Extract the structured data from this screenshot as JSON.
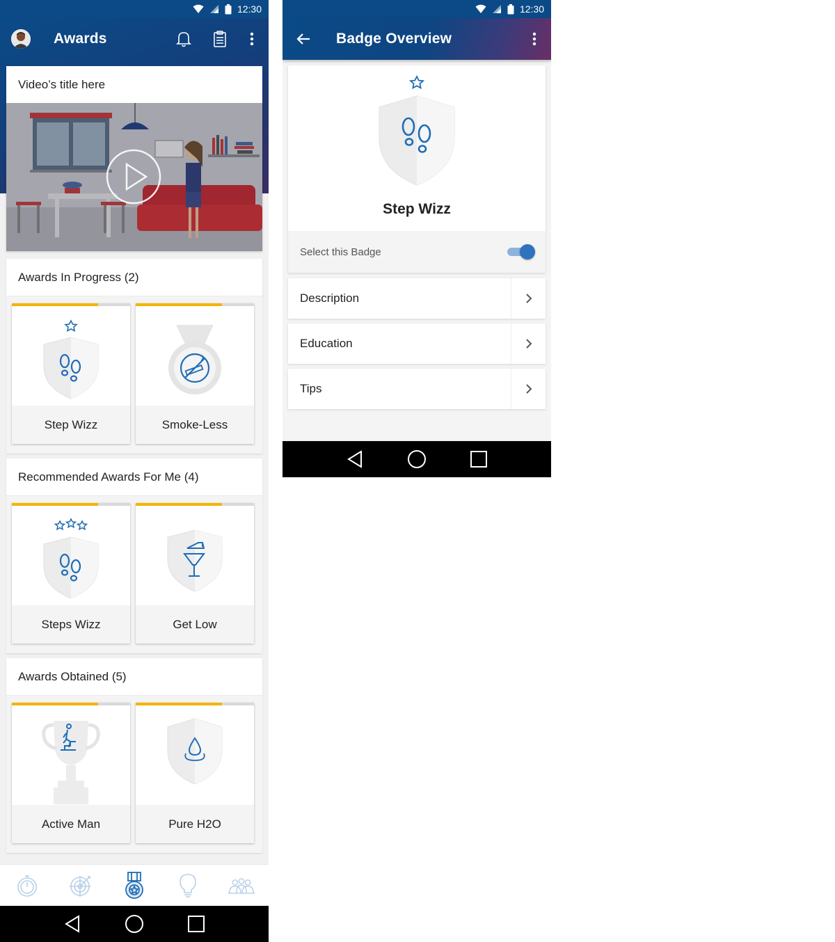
{
  "status_bar": {
    "time": "12:30"
  },
  "awards_screen": {
    "title": "Awards",
    "icons": [
      "avatar",
      "bell-icon",
      "clipboard-icon",
      "more-vert-icon"
    ],
    "video": {
      "title": "Video’s title here"
    },
    "sections": [
      {
        "title": "Awards In Progress (2)",
        "tiles": [
          {
            "label": "Step Wizz",
            "icon": "footsteps-shield-icon",
            "stars": 1,
            "progress": 0.73
          },
          {
            "label": "Smoke-Less",
            "icon": "no-smoking-medal-icon",
            "stars": 0,
            "progress": 0.73
          }
        ]
      },
      {
        "title": "Recommended Awards For Me (4)",
        "tiles": [
          {
            "label": "Steps Wizz",
            "icon": "footsteps-shield-icon",
            "stars": 3,
            "progress": 0.73
          },
          {
            "label": "Get Low",
            "icon": "cocktail-shield-icon",
            "stars": 0,
            "progress": 0.73
          }
        ]
      },
      {
        "title": "Awards Obtained (5)",
        "tiles": [
          {
            "label": "Active Man",
            "icon": "stairs-trophy-icon",
            "stars": 0,
            "progress": 0.73
          },
          {
            "label": "Pure H2O",
            "icon": "water-drop-shield-icon",
            "stars": 0,
            "progress": 0.73
          }
        ]
      }
    ],
    "bottom_nav": [
      "stopwatch-icon",
      "target-icon",
      "award-medal-icon",
      "lightbulb-icon",
      "community-icon"
    ],
    "active_nav": "award-medal-icon"
  },
  "badge_overview": {
    "title": "Badge Overview",
    "badge_name": "Step Wizz",
    "select_label": "Select this Badge",
    "selected": true,
    "rows": [
      "Description",
      "Education",
      "Tips"
    ]
  },
  "colors": {
    "header_blue": "#0a4b87",
    "accent_blue": "#2f72bf",
    "progress_yellow": "#f4b400",
    "icon_blue": "#1f6cb5"
  }
}
